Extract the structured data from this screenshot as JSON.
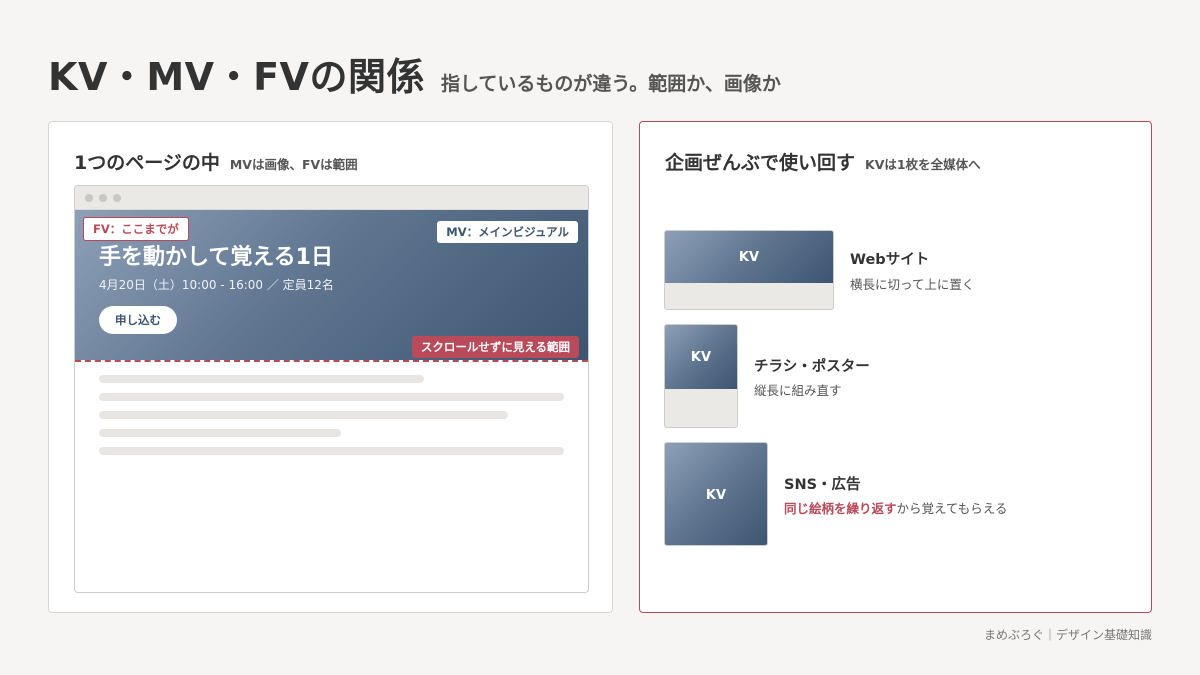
{
  "header": {
    "title": "KV・MV・FVの関係",
    "subtitle": "指しているものが違う。範囲か、画像か"
  },
  "left_card": {
    "title": "1つのページの中",
    "subtitle": "MVは画像、FVは範囲",
    "hero": {
      "fv_tag": "FV：ここまでが",
      "mv_tag": "MV：メインビジュアル",
      "headline": "手を動かして覚える1日",
      "date_line": "4月20日（土）10:00 - 16:00 ／ 定員12名",
      "cta_label": "申し込む",
      "scroll_tag": "スクロールせずに見える範囲"
    }
  },
  "right_card": {
    "title": "企画ぜんぶで使い回す",
    "subtitle": "KVは1枚を全媒体へ",
    "rows": [
      {
        "kv_label": "KV",
        "title": "Webサイト",
        "desc": "横長に切って上に置く"
      },
      {
        "kv_label": "KV",
        "title": "チラシ・ポスター",
        "desc": "縦長に組み直す"
      },
      {
        "kv_label": "KV",
        "title": "SNS・広告",
        "desc_accent": "同じ絵柄を繰り返す",
        "desc_rest": "から覚えてもらえる"
      }
    ]
  },
  "footer": {
    "text": "まめぶろぐ｜デザイン基礎知識"
  },
  "colors": {
    "accent": "#b84a5a",
    "kv_dark": "#3d5571",
    "kv_light": "#8ea0b8",
    "background": "#f6f5f3"
  }
}
